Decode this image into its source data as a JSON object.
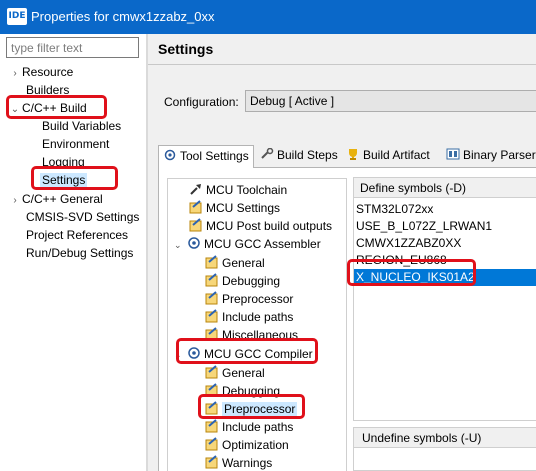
{
  "window": {
    "icon_text": "IDE",
    "title": "Properties for cmwx1zzabz_0xx"
  },
  "filter": {
    "placeholder": "type filter text"
  },
  "nav": {
    "items": [
      {
        "label": "Resource",
        "twisty": "›"
      },
      {
        "label": "Builders",
        "twisty": ""
      },
      {
        "label": "C/C++ Build",
        "twisty": "⌄"
      },
      {
        "label": "Build Variables",
        "twisty": ""
      },
      {
        "label": "Environment",
        "twisty": ""
      },
      {
        "label": "Logging",
        "twisty": ""
      },
      {
        "label": "Settings",
        "twisty": ""
      },
      {
        "label": "C/C++ General",
        "twisty": "›"
      },
      {
        "label": "CMSIS-SVD Settings",
        "twisty": ""
      },
      {
        "label": "Project References",
        "twisty": ""
      },
      {
        "label": "Run/Debug Settings",
        "twisty": ""
      }
    ]
  },
  "main": {
    "title": "Settings",
    "configuration_label": "Configuration:",
    "configuration_value": "Debug  [ Active ]",
    "tabs": [
      {
        "label": "Tool Settings",
        "icon": "gear-icon"
      },
      {
        "label": "Build Steps",
        "icon": "wrench-icon"
      },
      {
        "label": "Build Artifact",
        "icon": "trophy-icon"
      },
      {
        "label": "Binary Parsers",
        "icon": "binary-icon"
      }
    ],
    "tool_tree": [
      {
        "label": "MCU Toolchain",
        "icon": "toolchain-icon",
        "twisty": ""
      },
      {
        "label": "MCU Settings",
        "icon": "settings-page-icon",
        "twisty": ""
      },
      {
        "label": "MCU Post build outputs",
        "icon": "settings-page-icon",
        "twisty": ""
      },
      {
        "label": "MCU GCC Assembler",
        "icon": "tool-icon",
        "twisty": "⌄"
      },
      {
        "label": "General",
        "icon": "settings-page-icon",
        "twisty": ""
      },
      {
        "label": "Debugging",
        "icon": "settings-page-icon",
        "twisty": ""
      },
      {
        "label": "Preprocessor",
        "icon": "settings-page-icon",
        "twisty": ""
      },
      {
        "label": "Include paths",
        "icon": "settings-page-icon",
        "twisty": ""
      },
      {
        "label": "Miscellaneous",
        "icon": "settings-page-icon",
        "twisty": ""
      },
      {
        "label": "MCU GCC Compiler",
        "icon": "tool-icon",
        "twisty": "⌄"
      },
      {
        "label": "General",
        "icon": "settings-page-icon",
        "twisty": ""
      },
      {
        "label": "Debugging",
        "icon": "settings-page-icon",
        "twisty": ""
      },
      {
        "label": "Preprocessor",
        "icon": "settings-page-icon",
        "twisty": ""
      },
      {
        "label": "Include paths",
        "icon": "settings-page-icon",
        "twisty": ""
      },
      {
        "label": "Optimization",
        "icon": "settings-page-icon",
        "twisty": ""
      },
      {
        "label": "Warnings",
        "icon": "settings-page-icon",
        "twisty": ""
      }
    ],
    "define_symbols": {
      "header": "Define symbols (-D)",
      "items": [
        "STM32L072xx",
        "USE_B_L072Z_LRWAN1",
        "CMWX1ZZABZ0XX",
        "REGION_EU868",
        "X_NUCLEO_IKS01A2"
      ]
    },
    "undefine_symbols": {
      "header": "Undefine symbols (-U)"
    }
  },
  "colors": {
    "titlebar": "#0a68c9",
    "selection": "#0078d7",
    "highlight_annotation": "#e0101a"
  }
}
